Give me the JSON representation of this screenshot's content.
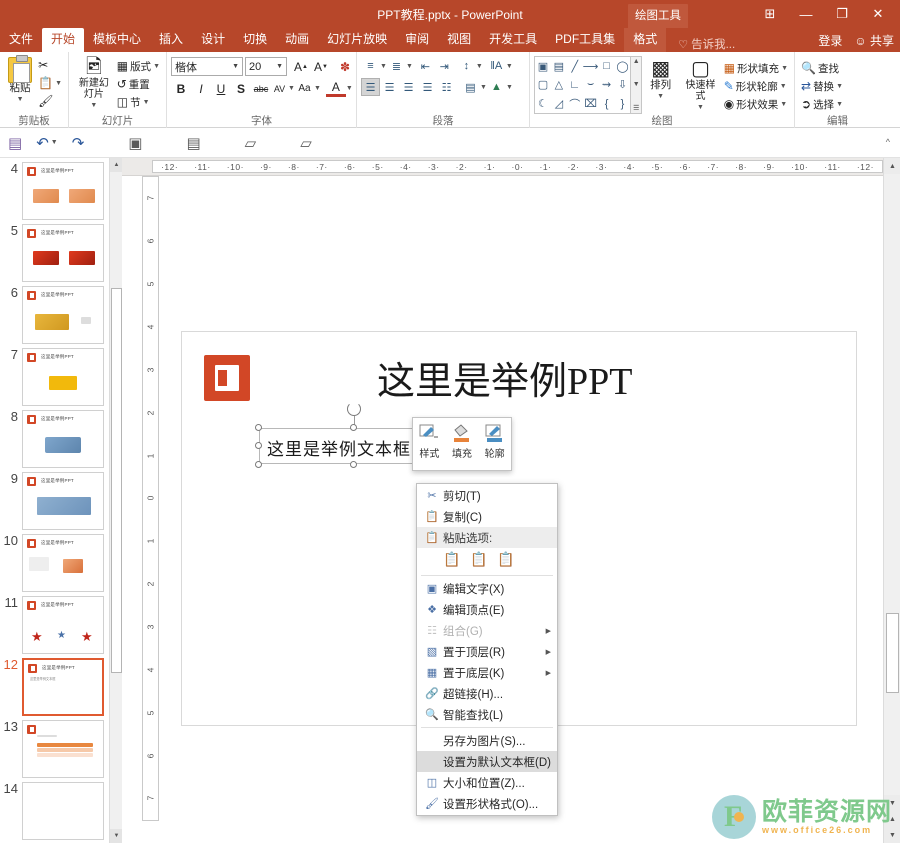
{
  "window": {
    "title": "PPT教程.pptx - PowerPoint",
    "contextual_tab_group": "绘图工具",
    "buttons": {
      "ribbon_display": "⊞",
      "minimize": "—",
      "maximize": "❐",
      "close": "✕"
    }
  },
  "tabs": [
    {
      "label": "文件",
      "state": "file"
    },
    {
      "label": "开始",
      "state": "active"
    },
    {
      "label": "模板中心",
      "state": "normal"
    },
    {
      "label": "插入",
      "state": "normal"
    },
    {
      "label": "设计",
      "state": "normal"
    },
    {
      "label": "切换",
      "state": "normal"
    },
    {
      "label": "动画",
      "state": "normal"
    },
    {
      "label": "幻灯片放映",
      "state": "normal"
    },
    {
      "label": "审阅",
      "state": "normal"
    },
    {
      "label": "视图",
      "state": "normal"
    },
    {
      "label": "开发工具",
      "state": "normal"
    },
    {
      "label": "PDF工具集",
      "state": "normal"
    },
    {
      "label": "格式",
      "state": "ctx-active"
    }
  ],
  "tell_me": "告诉我...",
  "account": {
    "sign_in": "登录",
    "share": "共享"
  },
  "ribbon": {
    "groups": [
      {
        "name": "剪贴板",
        "items": [
          {
            "label": "粘贴",
            "type": "big"
          },
          {
            "label": "剪切",
            "type": "small",
            "icon": "scissors-icon"
          },
          {
            "label": "复制",
            "type": "small",
            "icon": "copy-icon"
          },
          {
            "label": "格式刷",
            "type": "small",
            "icon": "format-painter-icon"
          }
        ]
      },
      {
        "name": "幻灯片",
        "items": [
          {
            "label": "新建幻灯片",
            "type": "big"
          },
          {
            "label": "版式",
            "type": "small"
          },
          {
            "label": "重置",
            "type": "small"
          },
          {
            "label": "节",
            "type": "small"
          }
        ]
      },
      {
        "name": "字体",
        "font_name": "楷体",
        "font_size": "20",
        "items": [
          {
            "label": "A",
            "name": "grow-font"
          },
          {
            "label": "A",
            "name": "shrink-font"
          },
          {
            "label": "B",
            "name": "bold"
          },
          {
            "label": "I",
            "name": "italic"
          },
          {
            "label": "U",
            "name": "underline"
          },
          {
            "label": "S",
            "name": "shadow"
          },
          {
            "label": "abc",
            "name": "strikethrough"
          },
          {
            "label": "AV",
            "name": "character-spacing"
          },
          {
            "label": "Aa",
            "name": "change-case"
          },
          {
            "label": "A",
            "name": "font-color"
          }
        ]
      },
      {
        "name": "段落"
      },
      {
        "name": "绘图",
        "items": [
          {
            "label": "排列"
          },
          {
            "label": "快速样式"
          },
          {
            "label": "形状填充"
          },
          {
            "label": "形状轮廓"
          },
          {
            "label": "形状效果"
          }
        ]
      },
      {
        "name": "编辑",
        "items": [
          {
            "label": "查找"
          },
          {
            "label": "替换"
          },
          {
            "label": "选择"
          }
        ]
      }
    ]
  },
  "quick_access": [
    {
      "name": "save-icon",
      "glyph": "▤"
    },
    {
      "name": "undo-icon",
      "glyph": "↶"
    },
    {
      "name": "redo-icon",
      "glyph": "↷"
    },
    {
      "name": "new-slide-icon",
      "glyph": "▣"
    },
    {
      "name": "text-box-icon",
      "glyph": "▤"
    },
    {
      "name": "start-slideshow-icon",
      "glyph": "▱"
    },
    {
      "name": "start-from-current-icon",
      "glyph": "▱"
    }
  ],
  "rulers": {
    "horizontal": [
      "12",
      "11",
      "10",
      "9",
      "8",
      "7",
      "6",
      "5",
      "4",
      "3",
      "2",
      "1",
      "0",
      "1",
      "2",
      "3",
      "4",
      "5",
      "6",
      "7",
      "8",
      "9",
      "10",
      "11",
      "12"
    ],
    "vertical": [
      "7",
      "6",
      "5",
      "4",
      "3",
      "2",
      "1",
      "0",
      "1",
      "2",
      "3",
      "4",
      "5",
      "6",
      "7"
    ]
  },
  "thumbnails": [
    {
      "number": "4",
      "title": "这里是举例PPT",
      "selected": false,
      "kind": "two-box-peach"
    },
    {
      "number": "5",
      "title": "这里是举例PPT",
      "selected": false,
      "kind": "two-box-red"
    },
    {
      "number": "6",
      "title": "这里是举例PPT",
      "selected": false,
      "kind": "one-box-gold"
    },
    {
      "number": "7",
      "title": "这里是举例PPT",
      "selected": false,
      "kind": "one-box-yellow"
    },
    {
      "number": "8",
      "title": "这里是举例PPT",
      "selected": false,
      "kind": "one-box-blue"
    },
    {
      "number": "9",
      "title": "这里是举例PPT",
      "selected": false,
      "kind": "banner-blue"
    },
    {
      "number": "10",
      "title": "这里是举例PPT",
      "selected": false,
      "kind": "list-peach"
    },
    {
      "number": "11",
      "title": "这里是举例PPT",
      "selected": false,
      "kind": "stars"
    },
    {
      "number": "12",
      "title": "这里是举例PPT",
      "selected": true,
      "kind": "text-only"
    },
    {
      "number": "13",
      "title": "",
      "selected": false,
      "kind": "table-peach"
    },
    {
      "number": "14",
      "title": "",
      "selected": false,
      "kind": "blank"
    }
  ],
  "slide": {
    "title": "这里是举例PPT",
    "textbox_value": "这里是举例文本框",
    "logo_letter": "P"
  },
  "mini_toolbar": [
    {
      "label": "样式",
      "icon": "shape-style-icon"
    },
    {
      "label": "填充",
      "icon": "fill-bucket-icon"
    },
    {
      "label": "轮廓",
      "icon": "outline-pen-icon"
    }
  ],
  "context_menu": {
    "paste_header": "粘贴选项:",
    "items": [
      {
        "label": "剪切(T)",
        "icon": "scissors-icon",
        "state": "normal",
        "submenu": false,
        "sep_after": false
      },
      {
        "label": "复制(C)",
        "icon": "copy-icon",
        "state": "normal",
        "submenu": false,
        "sep_after": false
      },
      {
        "label": "粘贴选项:",
        "icon": "paste-icon",
        "state": "header",
        "submenu": false,
        "sep_after": false
      },
      {
        "label": "编辑文字(X)",
        "icon": "edit-text-icon",
        "state": "normal",
        "submenu": false,
        "sep_after": false
      },
      {
        "label": "编辑顶点(E)",
        "icon": "edit-points-icon",
        "state": "normal",
        "submenu": false,
        "sep_after": false
      },
      {
        "label": "组合(G)",
        "icon": "group-icon",
        "state": "disabled",
        "submenu": true,
        "sep_after": false
      },
      {
        "label": "置于顶层(R)",
        "icon": "bring-front-icon",
        "state": "normal",
        "submenu": true,
        "sep_after": false
      },
      {
        "label": "置于底层(K)",
        "icon": "send-back-icon",
        "state": "normal",
        "submenu": true,
        "sep_after": false
      },
      {
        "label": "超链接(H)...",
        "icon": "hyperlink-icon",
        "state": "normal",
        "submenu": false,
        "sep_after": false
      },
      {
        "label": "智能查找(L)",
        "icon": "smart-lookup-icon",
        "state": "normal",
        "submenu": false,
        "sep_after": true
      },
      {
        "label": "另存为图片(S)...",
        "icon": "",
        "state": "normal",
        "submenu": false,
        "sep_after": false
      },
      {
        "label": "设置为默认文本框(D)",
        "icon": "",
        "state": "highlighted",
        "submenu": false,
        "sep_after": false
      },
      {
        "label": "大小和位置(Z)...",
        "icon": "size-position-icon",
        "state": "normal",
        "submenu": false,
        "sep_after": false
      },
      {
        "label": "设置形状格式(O)...",
        "icon": "format-shape-icon",
        "state": "normal",
        "submenu": false,
        "sep_after": false
      }
    ],
    "paste_option_icons": [
      "paste-keep-source-icon",
      "paste-merge-icon",
      "paste-text-only-icon"
    ]
  },
  "watermark": {
    "name": "欧菲资源网",
    "url": "www.office26.com",
    "letter": "F"
  },
  "colors": {
    "brand": "#b7472a",
    "brand_light": "#c0583c",
    "selection": "#e05a30",
    "accent_blue": "#4a6fa5"
  }
}
